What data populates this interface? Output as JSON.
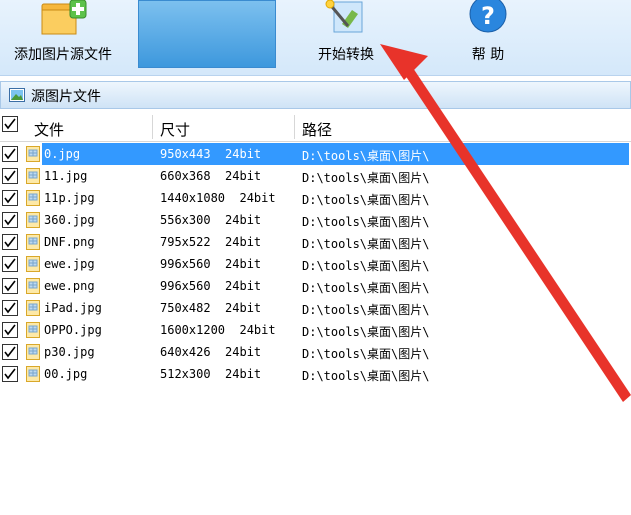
{
  "toolbar": {
    "add_label": "添加图片源文件",
    "start_label": "开始转换",
    "help_label": "帮 助"
  },
  "panel": {
    "title": "源图片文件"
  },
  "columns": {
    "file": "文件",
    "size": "尺寸",
    "path": "路径"
  },
  "files": [
    {
      "name": "0.jpg",
      "size": "950x443  24bit",
      "path": "D:\\tools\\桌面\\图片\\",
      "checked": true,
      "selected": true
    },
    {
      "name": "11.jpg",
      "size": "660x368  24bit",
      "path": "D:\\tools\\桌面\\图片\\",
      "checked": true,
      "selected": false
    },
    {
      "name": "11p.jpg",
      "size": "1440x1080  24bit",
      "path": "D:\\tools\\桌面\\图片\\",
      "checked": true,
      "selected": false
    },
    {
      "name": "360.jpg",
      "size": "556x300  24bit",
      "path": "D:\\tools\\桌面\\图片\\",
      "checked": true,
      "selected": false
    },
    {
      "name": "DNF.png",
      "size": "795x522  24bit",
      "path": "D:\\tools\\桌面\\图片\\",
      "checked": true,
      "selected": false
    },
    {
      "name": "ewe.jpg",
      "size": "996x560  24bit",
      "path": "D:\\tools\\桌面\\图片\\",
      "checked": true,
      "selected": false
    },
    {
      "name": "ewe.png",
      "size": "996x560  24bit",
      "path": "D:\\tools\\桌面\\图片\\",
      "checked": true,
      "selected": false
    },
    {
      "name": "iPad.jpg",
      "size": "750x482  24bit",
      "path": "D:\\tools\\桌面\\图片\\",
      "checked": true,
      "selected": false
    },
    {
      "name": "OPPO.jpg",
      "size": "1600x1200  24bit",
      "path": "D:\\tools\\桌面\\图片\\",
      "checked": true,
      "selected": false
    },
    {
      "name": "p30.jpg",
      "size": "640x426  24bit",
      "path": "D:\\tools\\桌面\\图片\\",
      "checked": true,
      "selected": false
    },
    {
      "name": "00.jpg",
      "size": "512x300  24bit",
      "path": "D:\\tools\\桌面\\图片\\",
      "checked": true,
      "selected": false
    }
  ],
  "colors": {
    "selection": "#3399ff",
    "annotation_arrow": "#e8332a"
  },
  "icons": {
    "add": "folder-add-icon",
    "start": "magic-wand-icon",
    "help": "help-icon",
    "panel": "picture-icon",
    "file": "image-file-icon"
  }
}
